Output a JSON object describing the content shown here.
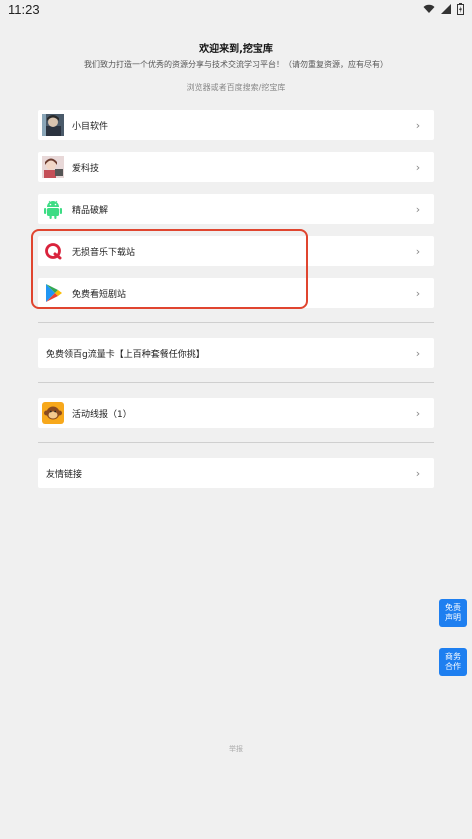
{
  "status_bar": {
    "time": "11:23"
  },
  "header": {
    "title": "欢迎来到,挖宝库",
    "subtitle": "我们致力打造一个优秀的资源分享与技术交流学习平台！（请勿重复资源，应有尽有）",
    "hint": "浏览器或者百度搜索/挖宝库"
  },
  "group1": [
    {
      "label": "小目软件",
      "icon": "avatar-anime-icon"
    },
    {
      "label": "爱科技",
      "icon": "avatar-girl-icon"
    },
    {
      "label": "精品破解",
      "icon": "android-icon"
    },
    {
      "label": "无损音乐下载站",
      "icon": "music-q-icon"
    },
    {
      "label": "免费看短剧站",
      "icon": "play-store-icon"
    }
  ],
  "group2": {
    "label": "免费领百g流量卡【上百种套餐任你挑】"
  },
  "group3": {
    "label": "活动线报（1）",
    "icon": "monkey-icon"
  },
  "group4": {
    "label": "友情链接"
  },
  "side_buttons": {
    "disclaimer": "免责\n声明",
    "business": "商务\n合作"
  },
  "footer": {
    "text": "举报"
  },
  "colors": {
    "accent": "#1e7ff0",
    "highlight": "#e0452f"
  }
}
